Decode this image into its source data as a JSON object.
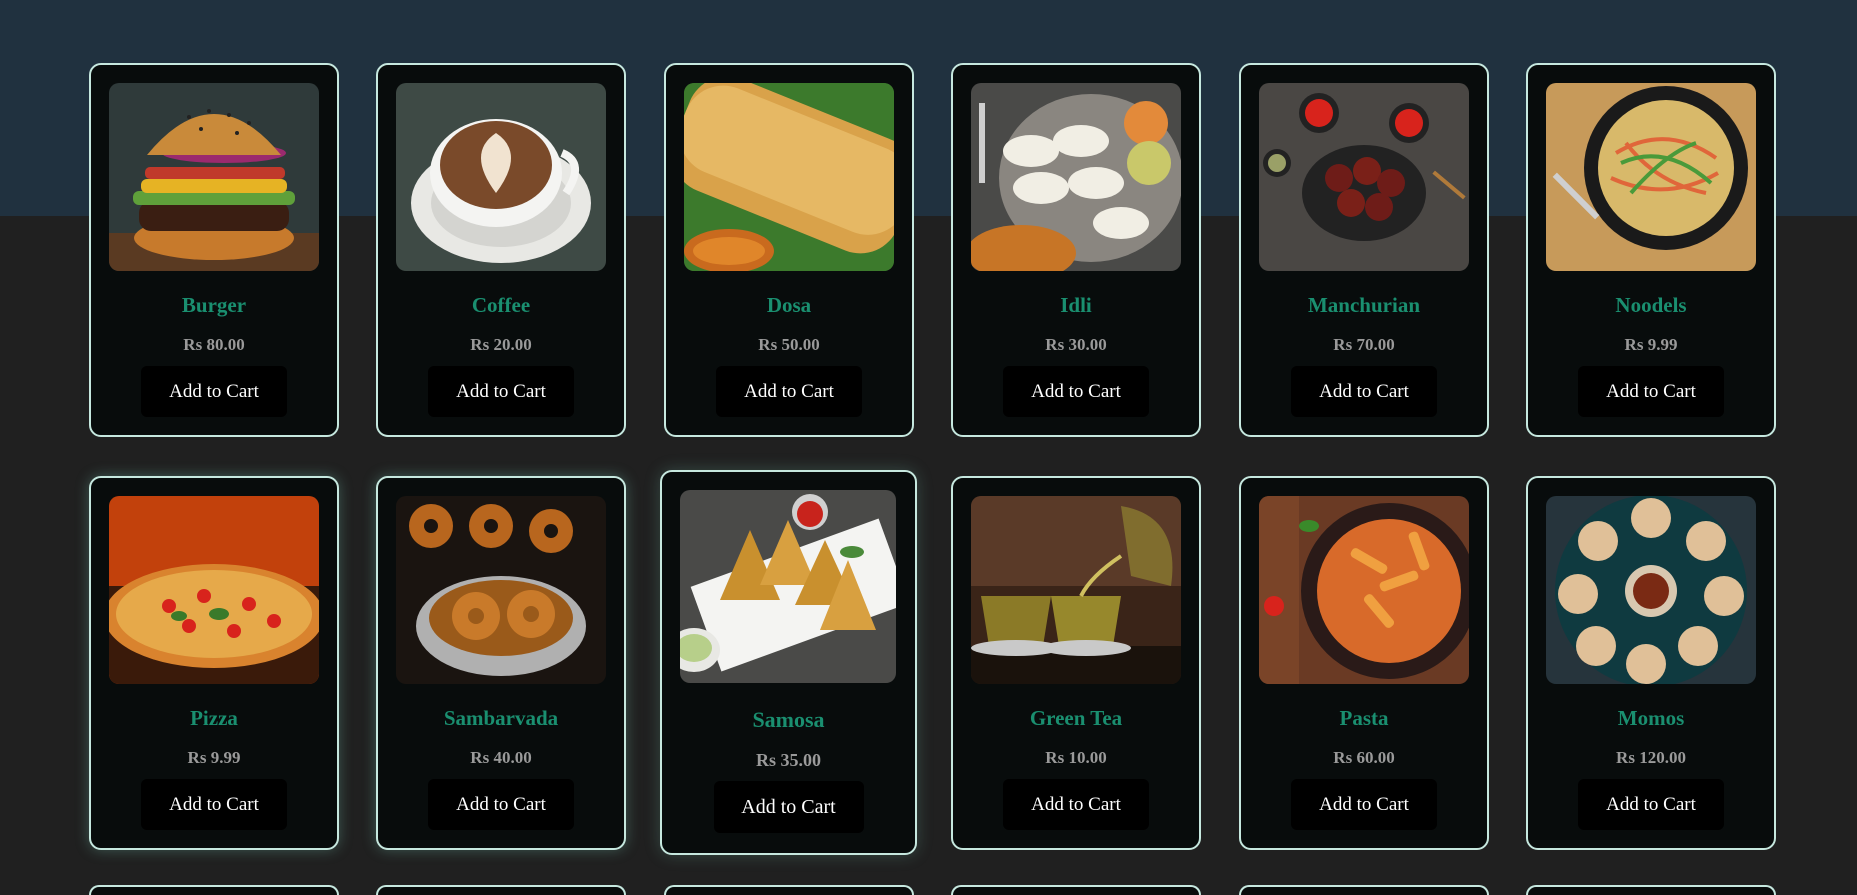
{
  "menu": {
    "add_to_cart_label": "Add to Cart",
    "items": [
      {
        "name": "Burger",
        "price": "Rs 80.00"
      },
      {
        "name": "Coffee",
        "price": "Rs 20.00"
      },
      {
        "name": "Dosa",
        "price": "Rs 50.00"
      },
      {
        "name": "Idli",
        "price": "Rs 30.00"
      },
      {
        "name": "Manchurian",
        "price": "Rs 70.00"
      },
      {
        "name": "Noodels",
        "price": "Rs 9.99"
      },
      {
        "name": "Pizza",
        "price": "Rs 9.99"
      },
      {
        "name": "Sambarvada",
        "price": "Rs 40.00"
      },
      {
        "name": "Samosa",
        "price": "Rs 35.00"
      },
      {
        "name": "Green Tea",
        "price": "Rs 10.00"
      },
      {
        "name": "Pasta",
        "price": "Rs 60.00"
      },
      {
        "name": "Momos",
        "price": "Rs 120.00"
      }
    ]
  },
  "theme": {
    "header_band": "#20313f",
    "page_background": "#202020",
    "card_background": "#080c0c",
    "card_border": "#c6e8df",
    "item_name": "#1a8f70",
    "item_price": "#9a9a9a",
    "button_background": "#000000"
  }
}
